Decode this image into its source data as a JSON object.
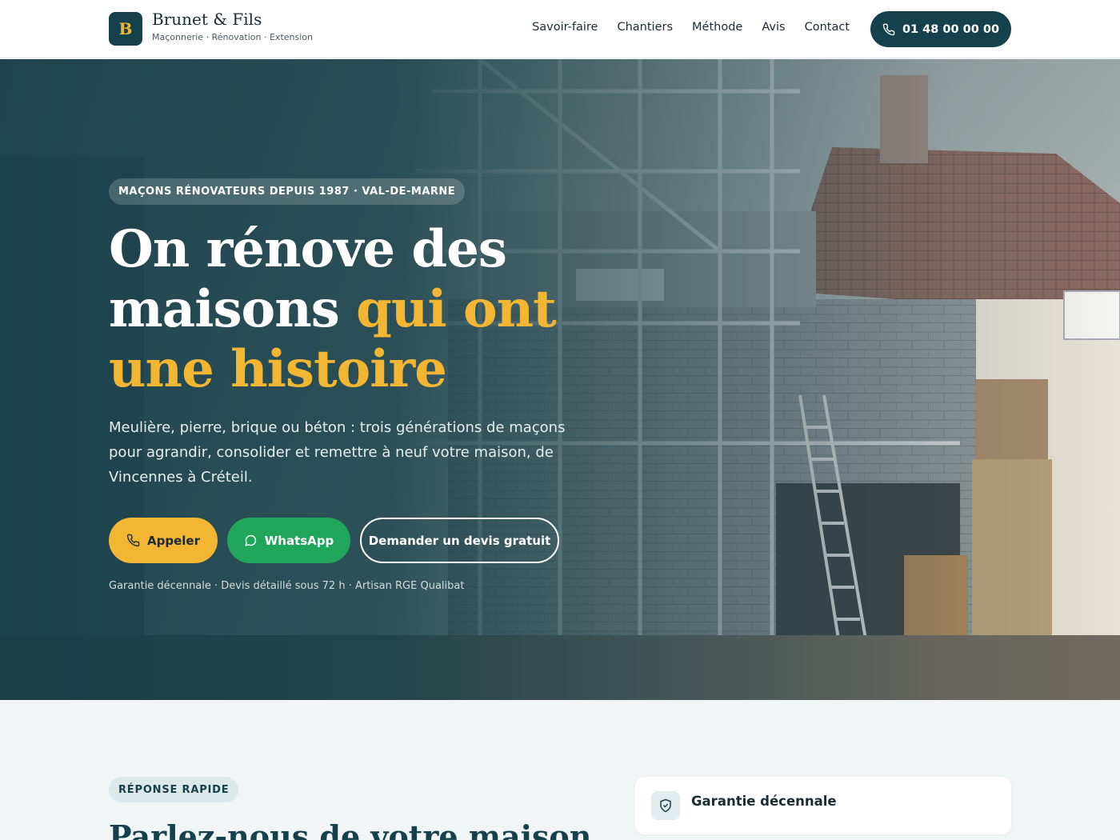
{
  "header": {
    "logo_letter": "B",
    "brand_name": "Brunet & Fils",
    "brand_tagline": "Maçonnerie · Rénovation · Extension",
    "nav": [
      {
        "label": "Savoir-faire"
      },
      {
        "label": "Chantiers"
      },
      {
        "label": "Méthode"
      },
      {
        "label": "Avis"
      },
      {
        "label": "Contact"
      }
    ],
    "phone_label": "01 48 00 00 00",
    "phone_icon": "phone-icon"
  },
  "hero": {
    "eyebrow": "MAÇONS RÉNOVATEURS DEPUIS 1987 · VAL-DE-MARNE",
    "title_part1": "On rénove des maisons ",
    "title_accent": "qui ont une histoire",
    "subtitle": "Meulière, pierre, brique ou béton : trois générations de maçons pour agrandir, consolider et remettre à neuf votre maison, de Vincennes à Créteil.",
    "buttons": {
      "call": "Appeler",
      "whatsapp": "WhatsApp",
      "quote": "Demander un devis gratuit"
    },
    "assurances": "Garantie décennale · Devis détaillé sous 72 h · Artisan RGE Qualibat",
    "background": "house-renovation-scaffolding-photo"
  },
  "section": {
    "badge": "RÉPONSE RAPIDE",
    "title": "Parlez-nous de votre maison",
    "card_title": "Garantie décennale",
    "card_icon": "shield-check-icon"
  },
  "colors": {
    "primary": "#15414d",
    "accent": "#f2b632",
    "whatsapp": "#1fa65a",
    "background": "#f1f5f5"
  }
}
